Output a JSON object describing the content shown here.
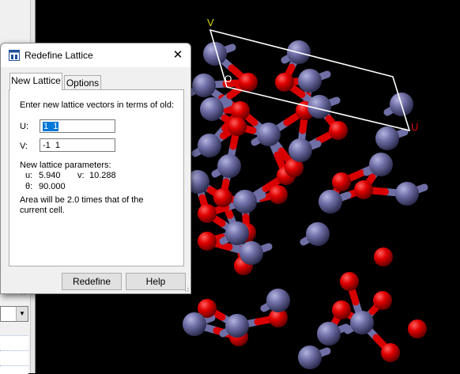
{
  "dialog": {
    "title": "Redefine Lattice",
    "close_label": "✕",
    "tabs": [
      {
        "label": "New Lattice",
        "active": true
      },
      {
        "label": "Options",
        "active": false
      }
    ],
    "instructions": "Enter new lattice vectors in terms of old:",
    "u_label": "U:",
    "u_value": "1  1",
    "v_label": "V:",
    "v_value": "-1  1",
    "params_heading": "New lattice parameters:",
    "u_param_label": "u:",
    "u_param_value": "5.940",
    "v_param_label": "v:",
    "v_param_value": "10.288",
    "theta_label": "θ:",
    "theta_value": "90.000",
    "area_note_line1": "Area will be 2.0 times that of the",
    "area_note_line2": "current cell.",
    "redefine_label": "Redefine",
    "help_label": "Help"
  },
  "viewer": {
    "axis_v_label": "V",
    "axis_o_label": "O",
    "axis_u_label": "U",
    "colors": {
      "background": "#000000",
      "oxygen": "#e60000",
      "metal": "#7474a8",
      "cell_outline": "#ffffff",
      "v_axis": "#d7d700",
      "u_axis": "#e00000"
    }
  },
  "background_window": {
    "close_label": "×",
    "dropdown_arrow": "▼"
  }
}
